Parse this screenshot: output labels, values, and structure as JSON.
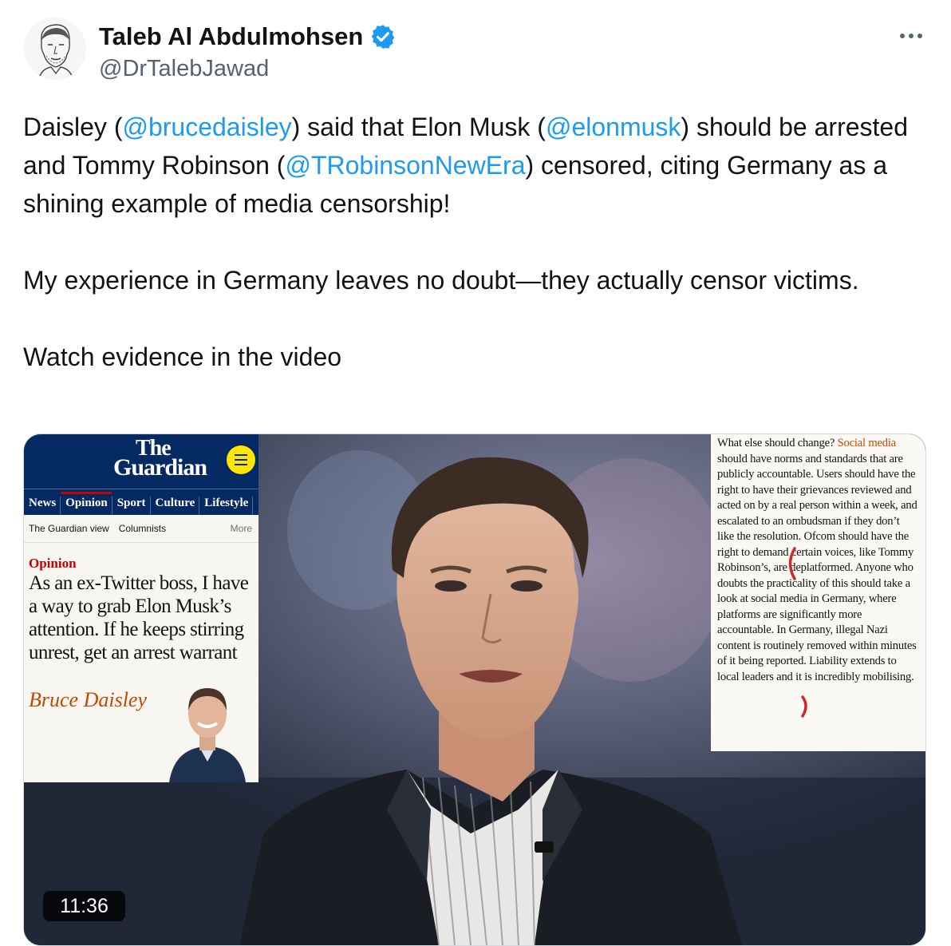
{
  "tweet": {
    "author_name": "Taleb Al Abdulmohsen",
    "handle": "@DrTalebJawad",
    "verified_icon": "verified-badge-icon",
    "more_icon": "more-options-icon",
    "text": {
      "p1_a": "Daisley (",
      "mention_1": "@brucedaisley",
      "p1_b": ") said that Elon Musk (",
      "mention_2": "@elonmusk",
      "p1_c": ") should be arrested and Tommy Robinson (",
      "mention_3": "@TRobinsonNewEra",
      "p1_d": ") censored, citing Germany as a shining example of media censorship!",
      "p2": "My experience in Germany leaves no doubt—they actually censor victims.",
      "p3": "Watch evidence in the video"
    }
  },
  "media": {
    "duration": "11:36",
    "guardian": {
      "logo_line1": "The",
      "logo_line2": "Guardian",
      "nav": [
        "News",
        "Opinion",
        "Sport",
        "Culture",
        "Lifestyle"
      ],
      "subnav": [
        "The Guardian view",
        "Columnists"
      ],
      "subnav_more": "More",
      "kicker": "Opinion",
      "headline": "As an ex-Twitter boss, I have a way to grab Elon Musk’s attention. If he keeps stirring unrest, get an arrest warrant",
      "author": "Bruce Daisley"
    },
    "article": {
      "text_a": "What else should change? ",
      "link": "Social media",
      "text_b": " should have norms and standards that are publicly accountable. Users should have the right to have their grievances reviewed and acted on by a real person within a week, and escalated to an ombudsman if they don’t like the resolution. Ofcom should have the right to demand certain voices, like Tommy Robinson’s, are deplatformed. Anyone who doubts the practicality of this should take a look at social media in Germany, where platforms are significantly more accountable. In Germany, illegal Nazi content is routinely removed within minutes of it being reported. Liability extends to local leaders and it is incredibly mobilising."
    },
    "colors": {
      "guardian_blue": "#052962",
      "guardian_yellow": "#ffe500",
      "mention_blue": "#1d9bf0",
      "annotation_red": "#d0282e"
    }
  }
}
